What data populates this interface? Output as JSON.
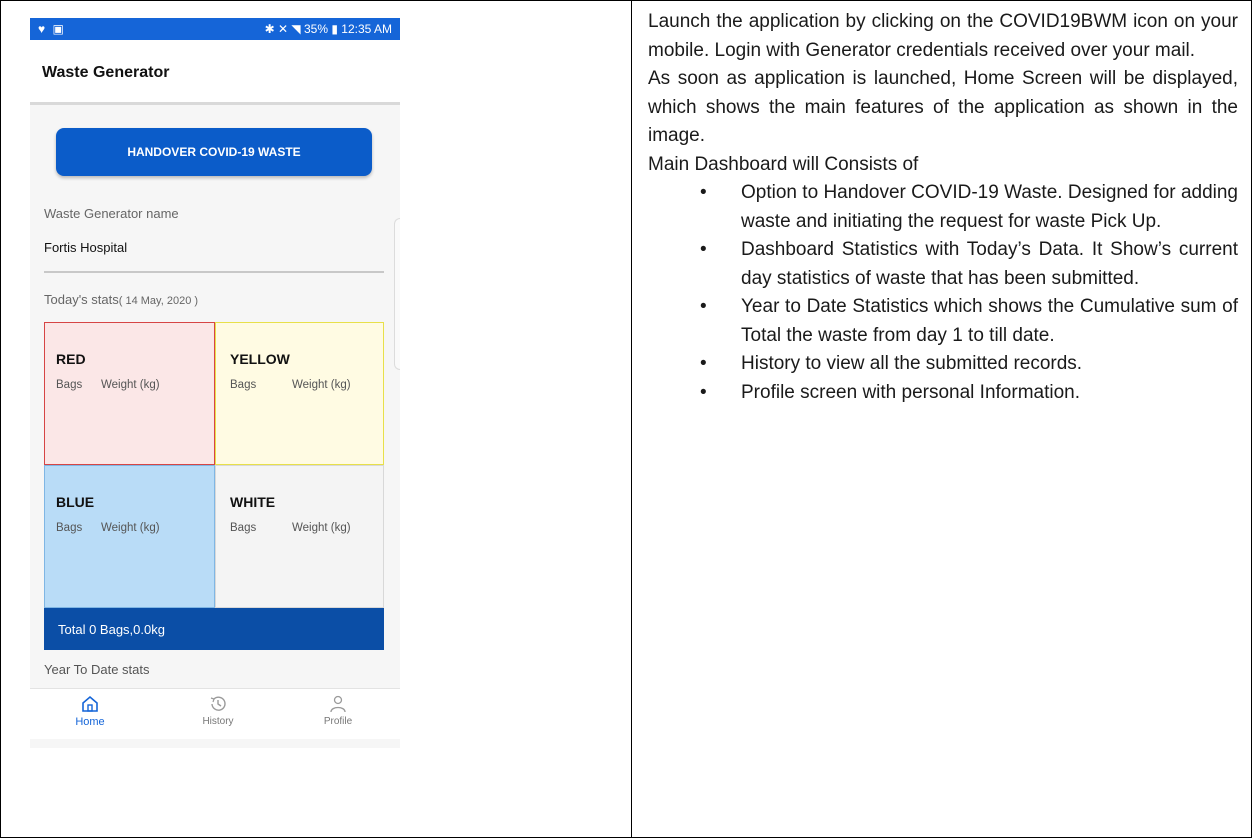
{
  "phone": {
    "status_left": "♥ ▣",
    "status_right": "✱ ✕ ◥ 35% ▮ 12:35 AM",
    "title": "Waste Generator",
    "handover_label": "HANDOVER COVID-19 WASTE",
    "generator_label": "Waste Generator name",
    "generator_name": "Fortis Hospital",
    "stats_label": "Today's stats",
    "stats_date": "( 14 May, 2020 )",
    "tiles": [
      {
        "name": "RED",
        "bags": "Bags",
        "weight": "Weight (kg)",
        "color": "#fbe7e7"
      },
      {
        "name": "YELLOW",
        "bags": "Bags",
        "weight": "Weight (kg)",
        "color": "#fffbe3"
      },
      {
        "name": "BLUE",
        "bags": "Bags",
        "weight": "Weight (kg)",
        "color": "#b9dcf7"
      },
      {
        "name": "WHITE",
        "bags": "Bags",
        "weight": "Weight (kg)",
        "color": "#f4f4f4"
      }
    ],
    "total_label": "Total 0 Bags,0.0kg",
    "ytd_label": "Year To Date stats",
    "nav": [
      {
        "label": "Home",
        "icon": "home-icon",
        "active": true
      },
      {
        "label": "History",
        "icon": "history-icon",
        "active": false
      },
      {
        "label": "Profile",
        "icon": "profile-icon",
        "active": false
      }
    ],
    "accent_color": "#1565d8"
  },
  "doc": {
    "para1": "Launch the application by clicking on the COVID19BWM icon on your mobile. Login with Generator credentials received over your mail.",
    "para2": "As soon as application is launched, Home Screen will be displayed, which shows the main features of the application as shown in the image.",
    "para3": "Main Dashboard will Consists of",
    "bullets": [
      "Option to Handover COVID-19 Waste. Designed for adding waste and initiating the request for waste Pick Up.",
      "Dashboard Statistics with Today’s Data. It Show’s current day statistics of waste that has been submitted.",
      "Year to Date Statistics which shows the Cumulative sum of Total the waste from day 1 to till date.",
      "History to view all the submitted records.",
      "Profile screen with personal Information."
    ]
  }
}
